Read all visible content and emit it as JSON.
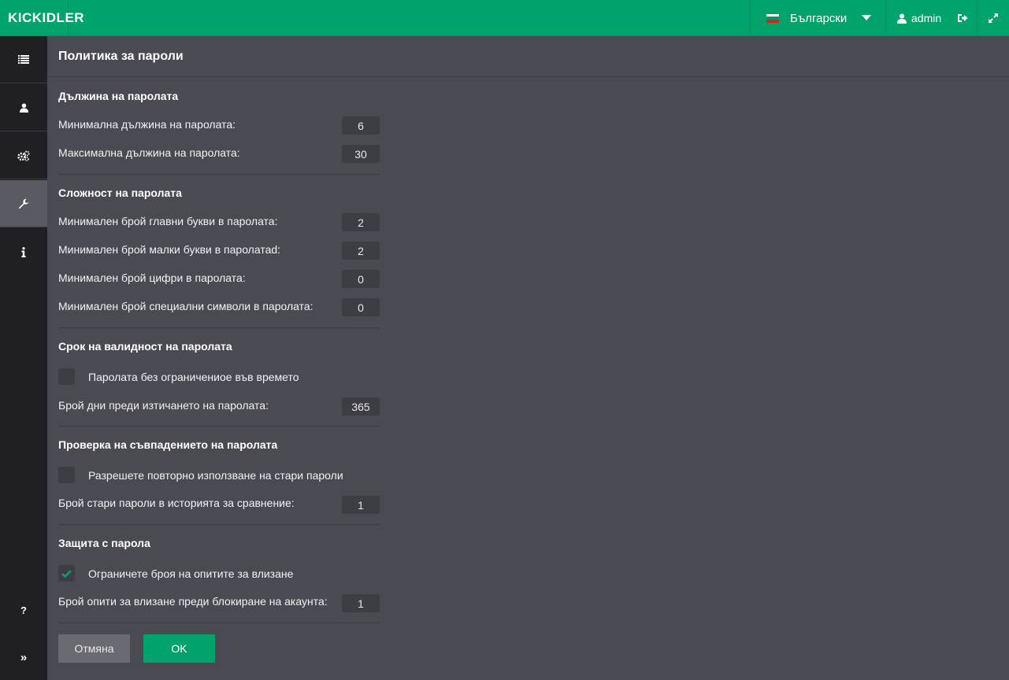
{
  "header": {
    "logo": "KICKIDLER",
    "language": "Български",
    "user": "admin"
  },
  "page": {
    "title": "Политика за пароли"
  },
  "sections": {
    "length": {
      "title": "Дължина на паролата",
      "min_label": "Минимална дължина на паролата:",
      "min_value": "6",
      "max_label": "Максимална дължина на паролата:",
      "max_value": "30"
    },
    "complexity": {
      "title": "Сложност на паролата",
      "upper_label": "Минимален брой главни букви в паролата:",
      "upper_value": "2",
      "lower_label": "Минимален брой малки букви в паролатаd:",
      "lower_value": "2",
      "digits_label": "Минимален брой цифри в паролата:",
      "digits_value": "0",
      "special_label": "Минимален брой специални символи в паролата:",
      "special_value": "0"
    },
    "validity": {
      "title": "Срок на валидност на паролата",
      "unlimited_label": "Паролата без ограничениое във времето",
      "unlimited_checked": false,
      "days_label": "Брой дни преди изтичането на паролата:",
      "days_value": "365"
    },
    "match": {
      "title": "Проверка на съвпадението на паролата",
      "reuse_label": "Разрешете повторно използване на стари пароли",
      "reuse_checked": false,
      "history_label": "Брой стари пароли в историята за сравнение:",
      "history_value": "1"
    },
    "protection": {
      "title": "Защита с парола",
      "limit_label": "Ограничете броя на опитите за влизане",
      "limit_checked": true,
      "attempts_label": "Брой опити за влизане преди блокиране на акаунта:",
      "attempts_value": "1"
    }
  },
  "buttons": {
    "cancel": "Отмяна",
    "ok": "OK"
  },
  "sidebar": {
    "items": [
      {
        "icon": "list-icon"
      },
      {
        "icon": "user-icon"
      },
      {
        "icon": "gears-icon"
      },
      {
        "icon": "wrench-icon",
        "active": true
      },
      {
        "icon": "info-icon"
      },
      {
        "icon": "help-icon"
      },
      {
        "icon": "collapse-icon"
      }
    ]
  },
  "colors": {
    "accent": "#00a36b",
    "background": "#4a4a52",
    "sidebar": "#1f1f24",
    "input": "#3d3d44"
  }
}
